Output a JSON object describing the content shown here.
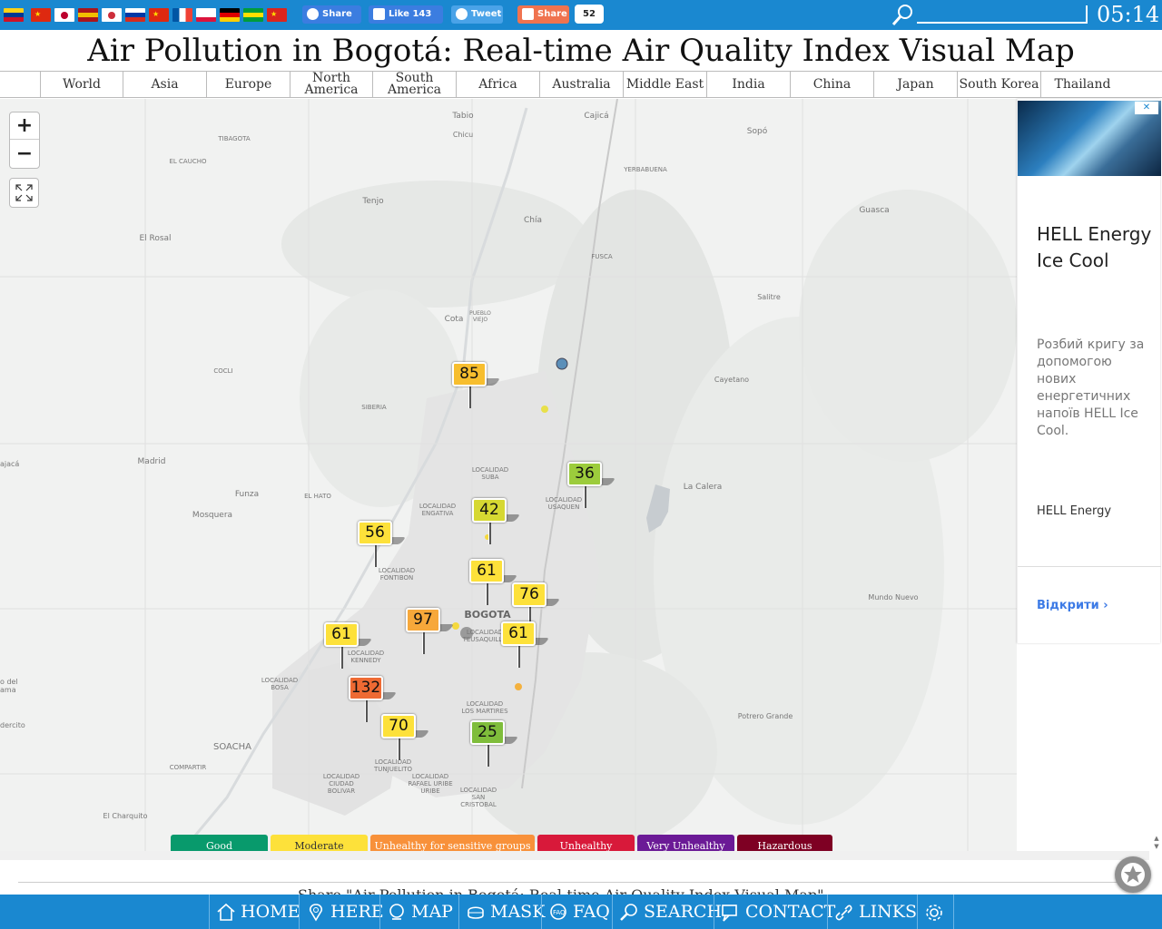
{
  "header": {
    "flags": [
      {
        "name": "colombia-flag",
        "colors": [
          "#fcd116",
          "#003893",
          "#ce1126"
        ]
      },
      {
        "name": "china-flag",
        "colors": [
          "#de2910",
          "#de2910",
          "#de2910"
        ]
      },
      {
        "name": "japan-flag",
        "colors": [
          "#ffffff",
          "#ffffff",
          "#ffffff"
        ]
      },
      {
        "name": "spain-flag",
        "colors": [
          "#aa151b",
          "#f1bf00",
          "#aa151b"
        ]
      },
      {
        "name": "korea-flag",
        "colors": [
          "#ffffff",
          "#ffffff",
          "#ffffff"
        ]
      },
      {
        "name": "russia-flag",
        "colors": [
          "#ffffff",
          "#0039a6",
          "#d52b1e"
        ]
      },
      {
        "name": "hongkong-flag",
        "colors": [
          "#de2910",
          "#de2910",
          "#de2910"
        ]
      },
      {
        "name": "france-flag",
        "colors": [
          "#0055a4",
          "#ffffff",
          "#ef4135"
        ]
      },
      {
        "name": "poland-flag",
        "colors": [
          "#ffffff",
          "#ffffff",
          "#dc143c"
        ]
      },
      {
        "name": "germany-flag",
        "colors": [
          "#000000",
          "#dd0000",
          "#ffce00"
        ]
      },
      {
        "name": "brazil-flag",
        "colors": [
          "#009c3b",
          "#ffdf00",
          "#009c3b"
        ]
      },
      {
        "name": "vietnam-flag",
        "colors": [
          "#da251d",
          "#da251d",
          "#da251d"
        ]
      }
    ],
    "share_fb_label": "Share",
    "like_label": "Like 143",
    "tweet_label": "Tweet",
    "share_label": "Share",
    "share_count": "52",
    "time": "05:14"
  },
  "page_title": "Air Pollution in Bogotá: Real-time Air Quality Index Visual Map",
  "tabs": [
    "World",
    "Asia",
    "Europe",
    "North America",
    "South America",
    "Africa",
    "Australia",
    "Middle East",
    "India",
    "China",
    "Japan",
    "South Korea",
    "Thailand"
  ],
  "map": {
    "zoom_in": "+",
    "zoom_out": "−",
    "places": [
      "Tabio",
      "Cajicá",
      "Chicu",
      "Sopó",
      "TIBAGOTA",
      "EL CAUCHO",
      "YERBABUENA",
      "Tenjo",
      "Chía",
      "Guasca",
      "El Rosal",
      "FUSCA",
      "Salitre",
      "Cota",
      "PUEBLO VIEJO",
      "COCLI",
      "Cayetano",
      "SIBERIA",
      "Madrid",
      "Funza",
      "EL HATO",
      "LOCALIDAD SUBA",
      "LOCALIDAD ENGATIVA",
      "LOCALIDAD USAQUEN",
      "La Calera",
      "Mosquera",
      "LOCALIDAD FONTIBON",
      "BOGOTA",
      "LOCALIDAD KENNEDY",
      "LOCALIDAD TEUSAQUILLO",
      "Mundo Nuevo",
      "LOCALIDAD BOSA",
      "LOCALIDAD LOS MARTIRES",
      "Potrero Grande",
      "SOACHA",
      "COMPARTIR",
      "LOCALIDAD CIUDAD BOLIVAR",
      "LOCALIDAD TUNJUELITO",
      "LOCALIDAD RAFAEL URIBE URIBE",
      "LOCALIDAD SAN CRISTOBAL",
      "El Charquito",
      "ajacá",
      "o del ama",
      "dercito"
    ],
    "stations": [
      {
        "aqi": "85",
        "color": "#f7be2e"
      },
      {
        "aqi": "36",
        "color": "#9ccc3c"
      },
      {
        "aqi": "42",
        "color": "#d6d832"
      },
      {
        "aqi": "56",
        "color": "#fde13a"
      },
      {
        "aqi": "61",
        "color": "#fde13a"
      },
      {
        "aqi": "76",
        "color": "#fde13a"
      },
      {
        "aqi": "97",
        "color": "#f7a83a"
      },
      {
        "aqi": "61",
        "color": "#fde13a"
      },
      {
        "aqi": "61",
        "color": "#fde13a"
      },
      {
        "aqi": "132",
        "color": "#ee6a33"
      },
      {
        "aqi": "70",
        "color": "#fde13a"
      },
      {
        "aqi": "25",
        "color": "#7fbd3b"
      }
    ],
    "legend": [
      {
        "label": "Good",
        "color": "#089a6c"
      },
      {
        "label": "Moderate",
        "color": "#fde13a"
      },
      {
        "label": "Unhealthy for sensitive groups",
        "color": "#f8913a"
      },
      {
        "label": "Unhealthy",
        "color": "#d8193a"
      },
      {
        "label": "Very Unhealthy",
        "color": "#6b1a96"
      },
      {
        "label": "Hazardous",
        "color": "#7e0023"
      }
    ]
  },
  "ad": {
    "close_label": "✕",
    "title": "HELL Energy Ice Cool",
    "description": "Розбий кригу за допомогою нових енергетичних напоїв HELL Ice Cool.",
    "brand": "HELL Energy",
    "cta": "Відкрити ›"
  },
  "share_text": "Share \"Air Pollution in Bogotá: Real-time Air Quality Index Visual Map\"",
  "nav": [
    "HOME",
    "HERE",
    "MAP",
    "MASK",
    "FAQ",
    "SEARCH",
    "CONTACT",
    "LINKS"
  ],
  "icons": {
    "nav": [
      "home-icon",
      "location-icon",
      "map-icon",
      "mask-icon",
      "faq-icon",
      "search-icon",
      "contact-icon",
      "links-icon",
      "settings-icon"
    ]
  }
}
